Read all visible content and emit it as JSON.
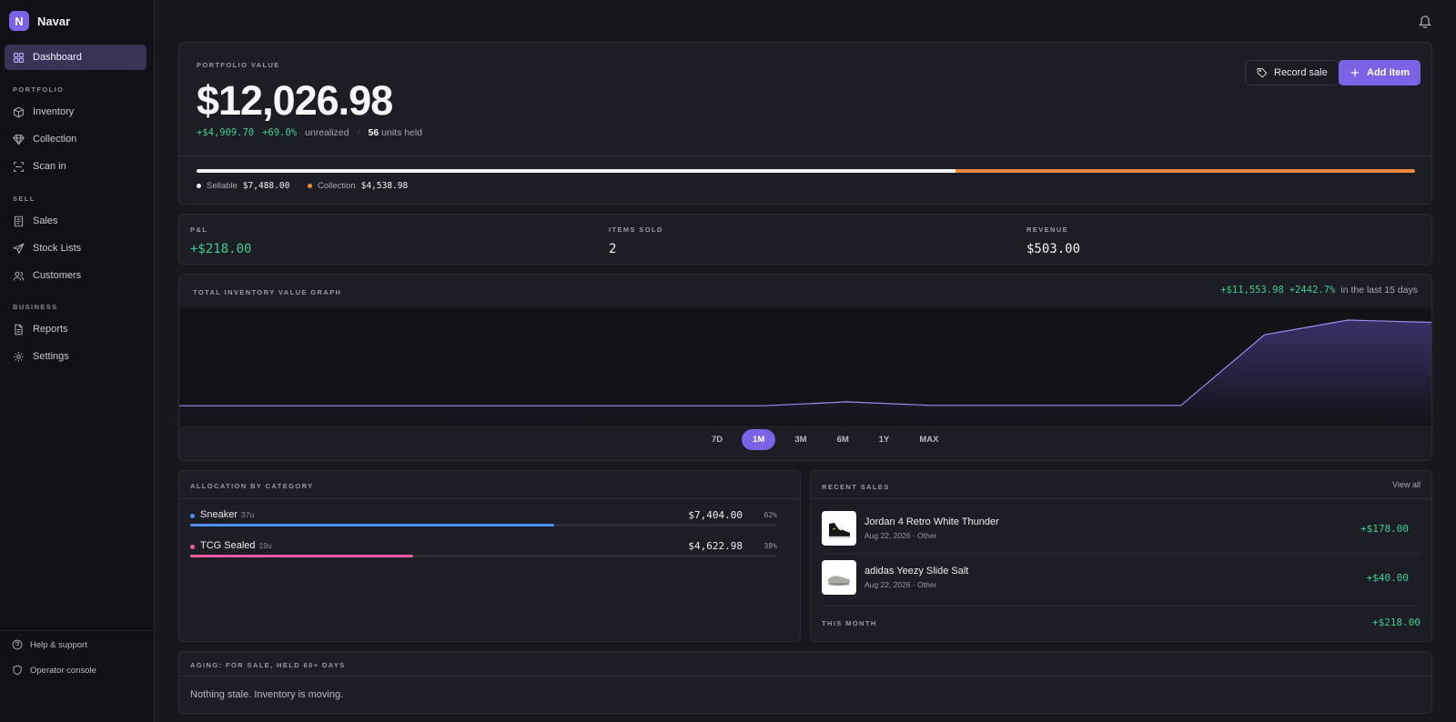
{
  "app": {
    "name": "Navar",
    "logo_letter": "N",
    "accent": "#7c63e6"
  },
  "sidebar": {
    "dashboard": "Dashboard",
    "sections": [
      {
        "title": "PORTFOLIO",
        "items": [
          "Inventory",
          "Collection",
          "Scan in"
        ]
      },
      {
        "title": "SELL",
        "items": [
          "Sales",
          "Stock Lists",
          "Customers"
        ]
      },
      {
        "title": "BUSINESS",
        "items": [
          "Reports",
          "Settings"
        ]
      }
    ],
    "footer": [
      "Help & support",
      "Operator console"
    ]
  },
  "portfolio": {
    "label": "PORTFOLIO VALUE",
    "value": "$12,026.98",
    "gain": "+$4,909.70",
    "gain_pct": "+69.0%",
    "unrealized": "unrealized",
    "separator": "/",
    "units": "56",
    "units_label": "units held",
    "record_sale": "Record sale",
    "add_item": "Add item",
    "split": {
      "sellable_label": "Sellable",
      "sellable_value": "$7,488.00",
      "sellable_share": 0.6226,
      "collection_label": "Collection",
      "collection_value": "$4,538.98",
      "collection_share": 0.3774,
      "sellable_color": "#f2f2f5",
      "collection_color": "#f0883e"
    }
  },
  "stats": [
    {
      "label": "P&L",
      "value": "+$218.00"
    },
    {
      "label": "ITEMS SOLD",
      "value": "2"
    },
    {
      "label": "REVENUE",
      "value": "$503.00"
    }
  ],
  "graph": {
    "title": "TOTAL INVENTORY VALUE GRAPH",
    "change": "+$11,553.98",
    "change_pct": "+2442.7%",
    "period_text": "in the last 15 days",
    "ranges": [
      "7D",
      "1M",
      "3M",
      "6M",
      "1Y",
      "MAX"
    ],
    "selected_range": "1M"
  },
  "chart_data": {
    "type": "area",
    "x": [
      1,
      2,
      3,
      4,
      5,
      6,
      7,
      8,
      9,
      10,
      11,
      12,
      13,
      14,
      15,
      16
    ],
    "values": [
      473,
      473,
      473,
      473,
      473,
      473,
      473,
      473,
      1000,
      520,
      520,
      520,
      520,
      10100,
      12100,
      11800
    ],
    "title": "TOTAL INVENTORY VALUE GRAPH",
    "ylim": [
      0,
      12600
    ],
    "grid": false
  },
  "allocation": {
    "title": "ALLOCATION BY CATEGORY",
    "rows": [
      {
        "name": "Sneaker",
        "units": "37u",
        "value": "$7,404.00",
        "pct": "62%",
        "share": 0.62,
        "color": "#4f8ff7"
      },
      {
        "name": "TCG Sealed",
        "units": "19u",
        "value": "$4,622.98",
        "pct": "38%",
        "share": 0.38,
        "color": "#ec5ba0"
      }
    ]
  },
  "recent_sales": {
    "title": "RECENT SALES",
    "view_all": "View all",
    "items": [
      {
        "name": "Jordan 4 Retro White Thunder",
        "meta": "Aug 22, 2026 · Other",
        "amount": "+$178.00"
      },
      {
        "name": "adidas Yeezy Slide Salt",
        "meta": "Aug 22, 2026 · Other",
        "amount": "+$40.00"
      }
    ],
    "month_label": "THIS MONTH",
    "month_value": "+$218.00"
  },
  "aging": {
    "title": "AGING: FOR SALE, HELD 60+ DAYS",
    "message": "Nothing stale. Inventory is moving."
  }
}
